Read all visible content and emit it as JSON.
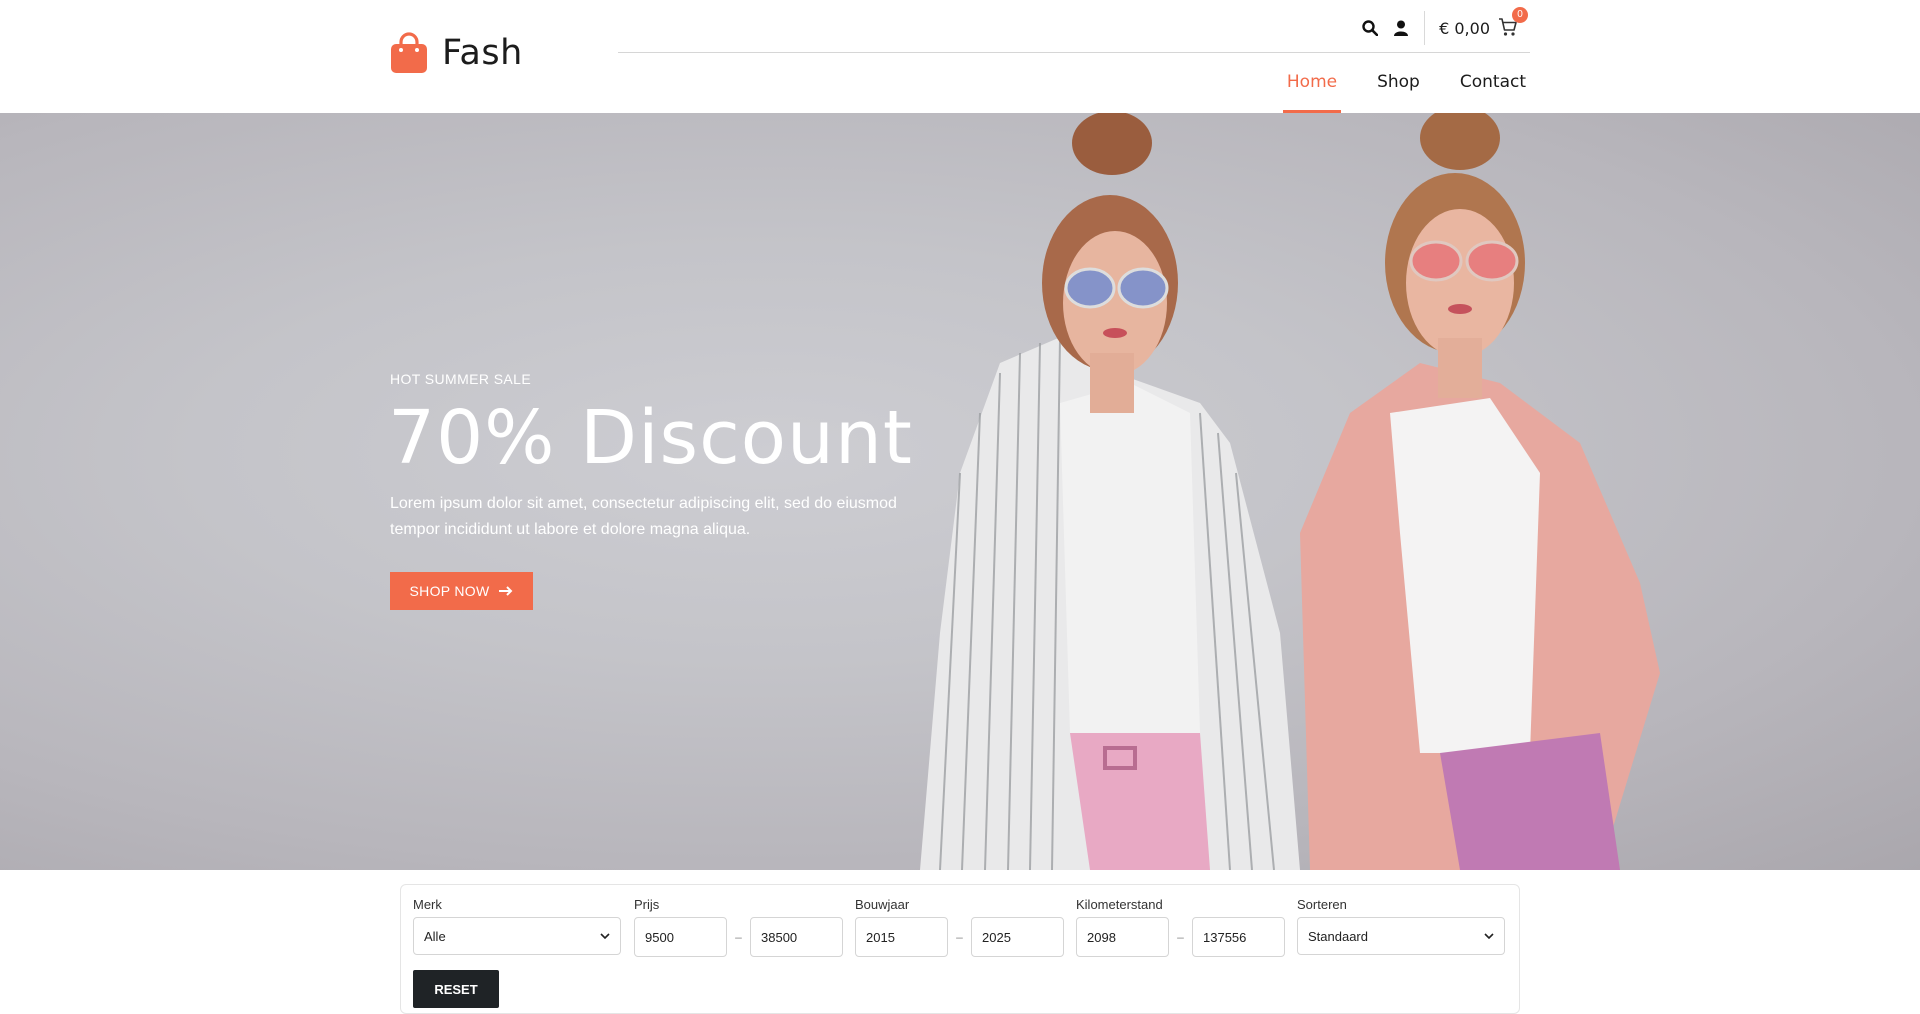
{
  "brand": {
    "name": "Fash",
    "accent": "#f26b4a",
    "icon": "shopping-bag-icon"
  },
  "topbar": {
    "cart_total": "€ 0,00",
    "cart_count": "0",
    "icons": [
      "search-icon",
      "user-icon",
      "cart-icon"
    ]
  },
  "nav": [
    {
      "label": "Home",
      "active": true
    },
    {
      "label": "Shop",
      "active": false
    },
    {
      "label": "Contact",
      "active": false
    }
  ],
  "hero": {
    "subtitle": "HOT SUMMER SALE",
    "title": "70% Discount",
    "description": "Lorem ipsum dolor sit amet, consectetur adipiscing elit, sed do eiusmod tempor incididunt ut labore et dolore magna aliqua.",
    "button_label": "SHOP NOW"
  },
  "filters": {
    "brand": {
      "label": "Merk",
      "value": "Alle"
    },
    "price": {
      "label": "Prijs",
      "min": "9500",
      "max": "38500"
    },
    "year": {
      "label": "Bouwjaar",
      "min": "2015",
      "max": "2025"
    },
    "mileage": {
      "label": "Kilometerstand",
      "min": "2098",
      "max": "137556"
    },
    "sort": {
      "label": "Sorteren",
      "value": "Standaard"
    },
    "range_separator": "–",
    "reset_label": "RESET"
  }
}
